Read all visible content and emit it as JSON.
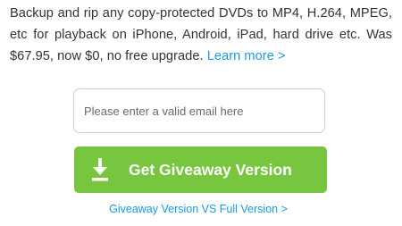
{
  "promo": {
    "description": "Backup and rip any copy-protected DVDs to MP4, H.264, MPEG, etc for playback on iPhone, Android, iPad, hard drive etc. Was $67.95, now $0, no free upgrade.",
    "learn_more_label": "Learn more >"
  },
  "email": {
    "value": "",
    "placeholder": "Please enter a valid email here"
  },
  "giveaway_button": {
    "label": "Get Giveaway Version",
    "icon": "download-icon"
  },
  "compare_link": {
    "label": "Giveaway Version VS Full Version >"
  },
  "colors": {
    "accent_green": "#78c53f",
    "link_blue": "#1a9ae3",
    "text": "#333333"
  }
}
